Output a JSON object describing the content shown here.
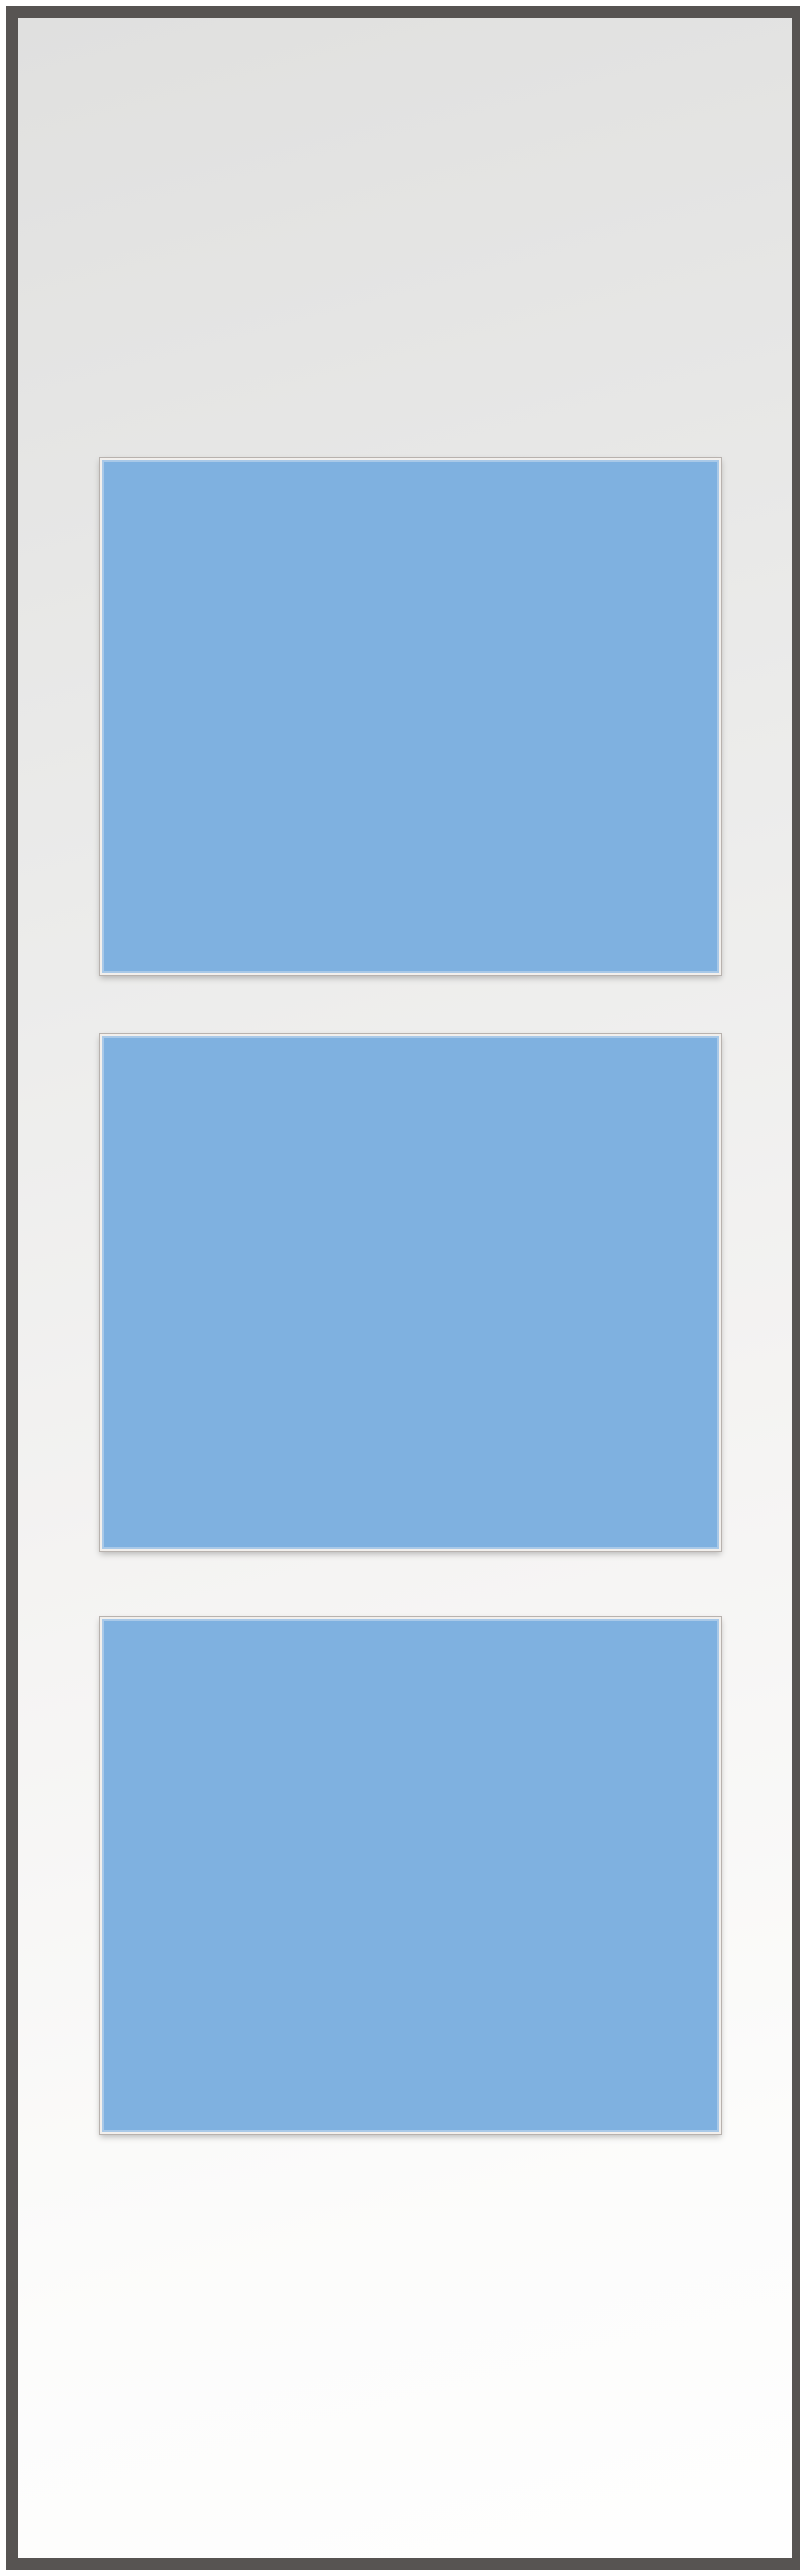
{
  "colors": {
    "frame_border": "#575452",
    "panel_fill": "#7fb1e0",
    "background_top": "#e0e0df",
    "background_bottom": "#fefefe"
  },
  "panels": [
    {
      "id": "panel-1"
    },
    {
      "id": "panel-2"
    },
    {
      "id": "panel-3"
    }
  ]
}
